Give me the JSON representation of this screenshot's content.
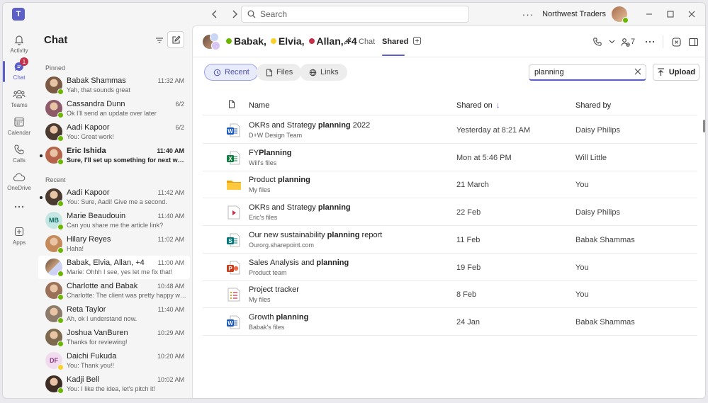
{
  "app": {
    "logo_letter": "T"
  },
  "titlebar": {
    "search_placeholder": "Search",
    "org_name": "Northwest Traders"
  },
  "rail": [
    {
      "id": "activity",
      "label": "Activity",
      "icon": "bell-icon"
    },
    {
      "id": "chat",
      "label": "Chat",
      "icon": "chat-icon",
      "badge": "1",
      "active": true
    },
    {
      "id": "teams",
      "label": "Teams",
      "icon": "teams-icon"
    },
    {
      "id": "calendar",
      "label": "Calendar",
      "icon": "calendar-icon"
    },
    {
      "id": "calls",
      "label": "Calls",
      "icon": "phone-icon"
    },
    {
      "id": "onedrive",
      "label": "OneDrive",
      "icon": "cloud-icon"
    },
    {
      "id": "more",
      "label": "",
      "icon": "more-icon"
    },
    {
      "id": "apps",
      "label": "Apps",
      "icon": "apps-icon"
    }
  ],
  "chatlist": {
    "title": "Chat",
    "pinned_label": "Pinned",
    "recent_label": "Recent",
    "pinned": [
      {
        "name": "Babak Shammas",
        "preview": "Yah, that sounds great",
        "time": "11:32 AM",
        "avatar": "#7a5a44"
      },
      {
        "name": "Cassandra Dunn",
        "preview": "Ok I'll send an update over later",
        "time": "6/2",
        "avatar": "#8d5a6a"
      },
      {
        "name": "Aadi Kapoor",
        "preview": "You: Great work!",
        "time": "6/2",
        "avatar": "#4a3a30"
      },
      {
        "name": "Eric Ishida",
        "preview": "Sure, I'll set up something for next week to...",
        "time": "11:40 AM",
        "avatar": "#b5634a",
        "unread": true
      }
    ],
    "recent": [
      {
        "name": "Aadi Kapoor",
        "preview": "You: Sure, Aadi! Give me a second.",
        "time": "11:42 AM",
        "avatar": "#4a3a30",
        "dot": true
      },
      {
        "name": "Marie Beaudouin",
        "preview": "Can you share me the article link?",
        "time": "11:40 AM",
        "initials": "MB",
        "initials_bg": "#c5e7e4",
        "initials_color": "#0e6b63"
      },
      {
        "name": "Hilary Reyes",
        "preview": "Haha!",
        "time": "11:02 AM",
        "avatar": "#c48a5a"
      },
      {
        "name": "Babak, Elvia, Allan, +4",
        "preview": "Marie: Ohhh I see, yes let me fix that!",
        "time": "11:00 AM",
        "group": true,
        "selected": true
      },
      {
        "name": "Charlotte and Babak",
        "preview": "Charlotte: The client was pretty happy with...",
        "time": "10:48 AM",
        "avatar": "#9a7058"
      },
      {
        "name": "Reta Taylor",
        "preview": "Ah, ok I understand now.",
        "time": "11:40 AM",
        "avatar": "#8c7a6a"
      },
      {
        "name": "Joshua VanBuren",
        "preview": "Thanks for reviewing!",
        "time": "10:29 AM",
        "avatar": "#7d6a4e"
      },
      {
        "name": "Daichi Fukuda",
        "preview": "You: Thank you!!",
        "time": "10:20 AM",
        "initials": "DF",
        "initials_bg": "#f1dcef",
        "initials_color": "#8a3a80",
        "away": true
      },
      {
        "name": "Kadji Bell",
        "preview": "You: I like the idea, let's pitch it!",
        "time": "10:02 AM",
        "avatar": "#3e2d24"
      }
    ]
  },
  "main": {
    "title_parts": [
      {
        "name": "Babak,",
        "status": "#6bb700"
      },
      {
        "name": "Elvia,",
        "status": "#f8d22a"
      },
      {
        "name": "Allan,",
        "status": "#c4314b"
      },
      {
        "name": "+4",
        "status": ""
      }
    ],
    "tabs": [
      {
        "label": "Chat",
        "active": false
      },
      {
        "label": "Shared",
        "active": true
      }
    ],
    "participant_count": "7",
    "filters": [
      {
        "label": "Recent",
        "icon": "history-icon",
        "active": true
      },
      {
        "label": "Files",
        "icon": "file-icon",
        "active": false
      },
      {
        "label": "Links",
        "icon": "globe-icon",
        "active": false
      }
    ],
    "file_search_value": "planning",
    "upload_label": "Upload",
    "columns": {
      "name": "Name",
      "shared_on": "Shared on",
      "sort_arrow": "↓",
      "shared_by": "Shared by"
    },
    "files": [
      {
        "pre": "OKRs and Strategy ",
        "hl": "planning",
        "post": " 2022",
        "location": "D+W Design Team",
        "date": "Yesterday at 8:21 AM",
        "by": "Daisy Philips",
        "type": "word"
      },
      {
        "pre": "FY",
        "hl": "Planning",
        "post": "",
        "location": "Will's files",
        "date": "Mon at 5:46 PM",
        "by": "Will Little",
        "type": "excel"
      },
      {
        "pre": "Product ",
        "hl": "planning",
        "post": "",
        "location": "My files",
        "date": "21 March",
        "by": "You",
        "type": "folder"
      },
      {
        "pre": "OKRs and Strategy ",
        "hl": "planning",
        "post": "",
        "location": "Eric's files",
        "date": "22 Feb",
        "by": "Daisy Philips",
        "type": "video"
      },
      {
        "pre": "Our new sustainability ",
        "hl": "planning",
        "post": " report",
        "location": "Ourorg.sharepoint.com",
        "date": "11 Feb",
        "by": "Babak Shammas",
        "type": "sharepoint"
      },
      {
        "pre": "Sales Analysis and ",
        "hl": "planning",
        "post": "",
        "location": "Product team",
        "date": "19 Feb",
        "by": "You",
        "type": "powerpoint"
      },
      {
        "pre": "Project tracker",
        "hl": "",
        "post": "",
        "location": "My files",
        "date": "8 Feb",
        "by": "You",
        "type": "list"
      },
      {
        "pre": "Growth ",
        "hl": "planning",
        "post": "",
        "location": "Babak's files",
        "date": "24 Jan",
        "by": "Babak Shammas",
        "type": "word"
      }
    ]
  }
}
